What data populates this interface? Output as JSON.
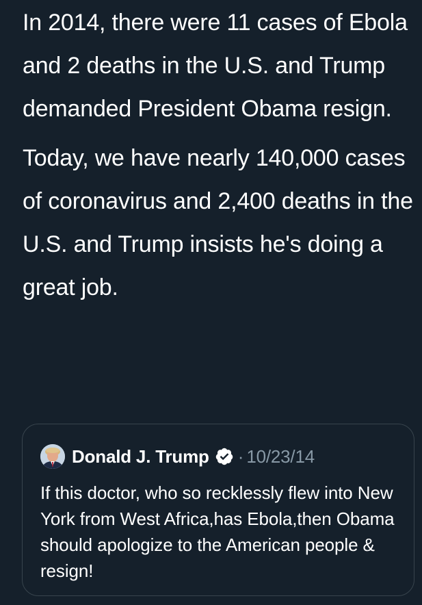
{
  "tweet": {
    "paragraphs": [
      "In 2014, there were 11 cases of Ebola and 2 deaths in the U.S. and Trump demanded President Obama resign.",
      "Today, we have nearly 140,000 cases of coronavirus and 2,400 deaths in the U.S. and Trump insists he's doing a great job."
    ]
  },
  "quoted_tweet": {
    "display_name": "Donald J. Trump",
    "verified_icon": "verified-badge-icon",
    "separator": "·",
    "date": "10/23/14",
    "text": "If this doctor, who so recklessly flew into New York from West Africa,has Ebola,then Obama should apologize to the American people & resign!"
  },
  "colors": {
    "background": "#15202b",
    "text_primary": "#ffffff",
    "text_secondary": "#8899a6",
    "card_border": "#38444d"
  }
}
